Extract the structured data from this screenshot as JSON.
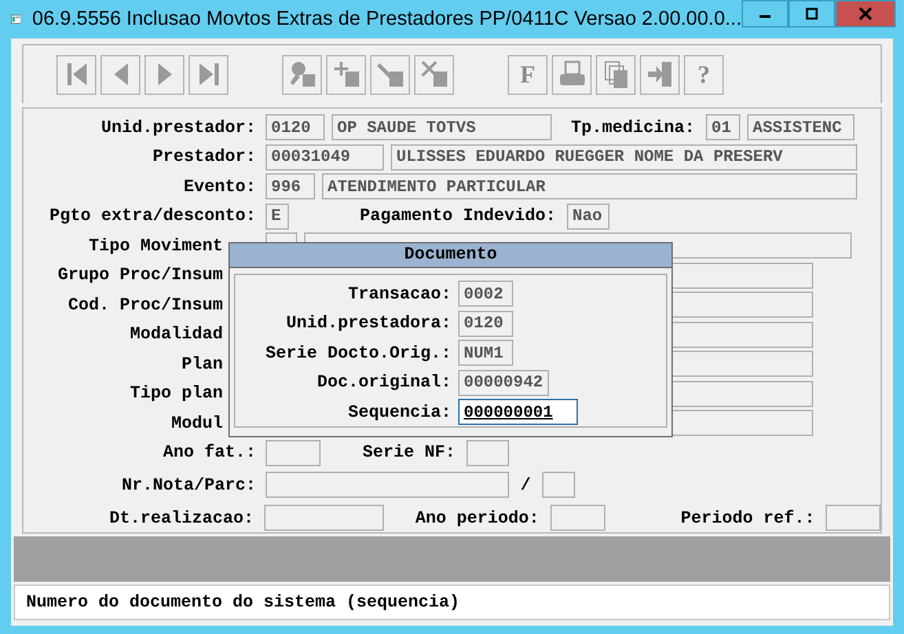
{
  "window": {
    "title": "06.9.5556   Inclusao  Movtos Extras de Prestadores PP/0411C Versao 2.00.00.0..."
  },
  "toolbar": [
    {
      "kind": "first"
    },
    {
      "kind": "prev"
    },
    {
      "kind": "next"
    },
    {
      "kind": "last"
    },
    {
      "kind": "gap"
    },
    {
      "kind": "search"
    },
    {
      "kind": "add"
    },
    {
      "kind": "edit"
    },
    {
      "kind": "delete"
    },
    {
      "kind": "gap"
    },
    {
      "kind": "glyph",
      "glyph": "F"
    },
    {
      "kind": "print"
    },
    {
      "kind": "copy"
    },
    {
      "kind": "exit"
    },
    {
      "kind": "glyph",
      "glyph": "?"
    }
  ],
  "form": {
    "unid_prestador": {
      "label": "Unid.prestador:",
      "code": "0120",
      "name": "OP SAUDE TOTVS"
    },
    "tp_medicina": {
      "label": "Tp.medicina:",
      "code": "01",
      "name": "ASSISTENC"
    },
    "prestador": {
      "label": "Prestador:",
      "code": "00031049",
      "name": "ULISSES EDUARDO RUEGGER NOME DA PRESERV"
    },
    "evento": {
      "label": "Evento:",
      "code": "996",
      "name": "ATENDIMENTO PARTICULAR"
    },
    "pgto": {
      "label": "Pgto extra/desconto:",
      "value": "E"
    },
    "pagamento_indevido": {
      "label": "Pagamento Indevido:",
      "value": "Nao"
    },
    "covered_labels": [
      "Tipo Moviment",
      "Grupo Proc/Insum",
      "Cod. Proc/Insum",
      "Modalidad",
      "Plan",
      "Tipo plan",
      "Modul"
    ],
    "ano_fat": {
      "label": "Ano fat.:"
    },
    "serie_nf": {
      "label": "Serie NF:"
    },
    "nr_nota": {
      "label": "Nr.Nota/Parc:",
      "separator": "/"
    },
    "dt_realizacao": {
      "label": "Dt.realizacao:"
    },
    "ano_periodo": {
      "label": "Ano periodo:"
    },
    "periodo_ref": {
      "label": "Periodo ref.:"
    }
  },
  "dialog": {
    "title": "Documento",
    "fields": [
      {
        "label": "Transacao:",
        "value": "0002",
        "kind": "readonly"
      },
      {
        "label": "Unid.prestadora:",
        "value": "0120",
        "kind": "readonly"
      },
      {
        "label": "Serie Docto.Orig.:",
        "value": "NUM1",
        "kind": "readonly"
      },
      {
        "label": "Doc.original:",
        "value": "00000942",
        "kind": "readonly"
      },
      {
        "label": "Sequencia:",
        "value": "000000001",
        "kind": "input"
      }
    ]
  },
  "status_bar": {
    "text": "Numero do documento do sistema (sequencia)"
  }
}
